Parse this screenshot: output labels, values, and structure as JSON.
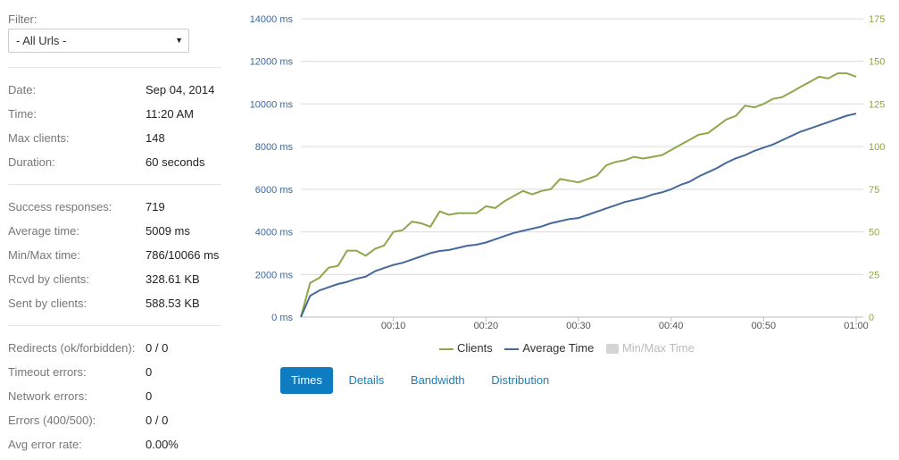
{
  "filter": {
    "label": "Filter:",
    "selected": "- All Urls -"
  },
  "summary": [
    {
      "label": "Date:",
      "value": "Sep 04, 2014"
    },
    {
      "label": "Time:",
      "value": "11:20 AM"
    },
    {
      "label": "Max clients:",
      "value": "148"
    },
    {
      "label": "Duration:",
      "value": "60 seconds"
    }
  ],
  "responses": [
    {
      "label": "Success responses:",
      "value": "719"
    },
    {
      "label": "Average time:",
      "value": "5009 ms"
    },
    {
      "label": "Min/Max time:",
      "value": "786/10066 ms"
    },
    {
      "label": "Rcvd by clients:",
      "value": "328.61 KB"
    },
    {
      "label": "Sent by clients:",
      "value": "588.53 KB"
    }
  ],
  "errors": [
    {
      "label": "Redirects (ok/forbidden):",
      "value": "0 / 0"
    },
    {
      "label": "Timeout errors:",
      "value": "0"
    },
    {
      "label": "Network errors:",
      "value": "0"
    },
    {
      "label": "Errors (400/500):",
      "value": "0 / 0"
    },
    {
      "label": "Avg error rate:",
      "value": "0.00%"
    }
  ],
  "tabs": [
    {
      "label": "Times",
      "active": true
    },
    {
      "label": "Details",
      "active": false
    },
    {
      "label": "Bandwidth",
      "active": false
    },
    {
      "label": "Distribution",
      "active": false
    }
  ],
  "colors": {
    "clients": "#8fa64a",
    "average_time": "#456a9a",
    "min_max_time": "#d4d4d4",
    "left_axis_text": "#3a6aa0",
    "right_axis_text": "#8fa64a",
    "grid": "#d9d9d9"
  },
  "chart_data": {
    "type": "line",
    "title": "",
    "x_tick_labels": [
      "00:10",
      "00:20",
      "00:30",
      "00:40",
      "00:50",
      "01:00"
    ],
    "x_tick_seconds": [
      10,
      20,
      30,
      40,
      50,
      60
    ],
    "xlim": [
      0,
      60
    ],
    "y_left": {
      "tick_labels": [
        "0 ms",
        "2000 ms",
        "4000 ms",
        "6000 ms",
        "8000 ms",
        "10000 ms",
        "12000 ms",
        "14000 ms"
      ],
      "tick_values": [
        0,
        2000,
        4000,
        6000,
        8000,
        10000,
        12000,
        14000
      ],
      "ylim": [
        0,
        14000
      ]
    },
    "y_right": {
      "tick_labels": [
        "0",
        "25",
        "50",
        "75",
        "100",
        "125",
        "150",
        "175"
      ],
      "tick_values": [
        0,
        25,
        50,
        75,
        100,
        125,
        150,
        175
      ],
      "ylim": [
        0,
        175
      ]
    },
    "grid": true,
    "legend_position": "bottom",
    "series": [
      {
        "name": "Clients",
        "axis": "right",
        "x": [
          0,
          1,
          2,
          3,
          4,
          5,
          6,
          7,
          8,
          9,
          10,
          11,
          12,
          13,
          14,
          15,
          16,
          17,
          18,
          19,
          20,
          21,
          22,
          23,
          24,
          25,
          26,
          27,
          28,
          29,
          30,
          31,
          32,
          33,
          34,
          35,
          36,
          37,
          38,
          39,
          40,
          41,
          42,
          43,
          44,
          45,
          46,
          47,
          48,
          49,
          50,
          51,
          52,
          53,
          54,
          55,
          56,
          57,
          58,
          59,
          60
        ],
        "values": [
          0,
          20,
          23,
          29,
          30,
          39,
          39,
          36,
          40,
          42,
          50,
          51,
          56,
          55,
          53,
          62,
          60,
          61,
          61,
          61,
          65,
          64,
          68,
          71,
          74,
          72,
          74,
          75,
          81,
          80,
          79,
          81,
          83,
          89,
          91,
          92,
          94,
          93,
          94,
          95,
          98,
          101,
          104,
          107,
          108,
          112,
          116,
          118,
          124,
          123,
          125,
          128,
          129,
          132,
          135,
          138,
          141,
          140,
          143,
          143,
          141
        ]
      },
      {
        "name": "Average Time",
        "axis": "left",
        "x": [
          0,
          1,
          2,
          3,
          4,
          5,
          6,
          7,
          8,
          9,
          10,
          11,
          12,
          13,
          14,
          15,
          16,
          17,
          18,
          19,
          20,
          21,
          22,
          23,
          24,
          25,
          26,
          27,
          28,
          29,
          30,
          31,
          32,
          33,
          34,
          35,
          36,
          37,
          38,
          39,
          40,
          41,
          42,
          43,
          44,
          45,
          46,
          47,
          48,
          49,
          50,
          51,
          52,
          53,
          54,
          55,
          56,
          57,
          58,
          59,
          60
        ],
        "values": [
          0,
          1000,
          1250,
          1400,
          1550,
          1650,
          1800,
          1900,
          2150,
          2300,
          2450,
          2550,
          2700,
          2850,
          3000,
          3100,
          3150,
          3250,
          3350,
          3400,
          3500,
          3650,
          3800,
          3950,
          4050,
          4150,
          4250,
          4400,
          4500,
          4600,
          4650,
          4800,
          4950,
          5100,
          5250,
          5400,
          5500,
          5600,
          5750,
          5850,
          6000,
          6200,
          6350,
          6600,
          6800,
          7000,
          7250,
          7450,
          7600,
          7800,
          7950,
          8100,
          8300,
          8500,
          8700,
          8850,
          9000,
          9150,
          9300,
          9450,
          9550
        ]
      },
      {
        "name": "Min/Max Time",
        "axis": "left",
        "hidden": true,
        "x": [],
        "values": []
      }
    ]
  }
}
